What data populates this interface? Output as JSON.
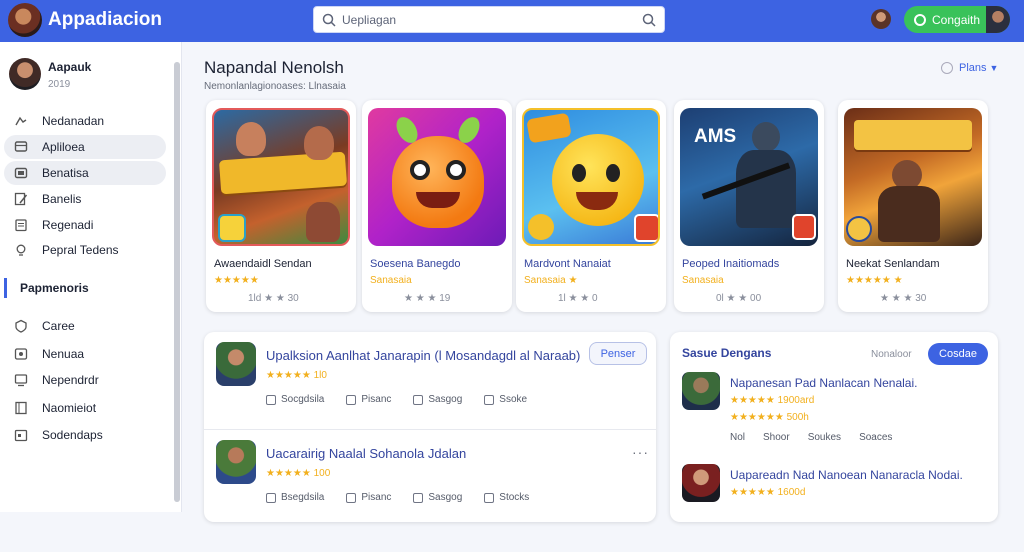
{
  "app": {
    "title": "Appadiacion"
  },
  "search": {
    "placeholder": "Uepliagan"
  },
  "topbar": {
    "cta_label": "Congaith"
  },
  "sidebar": {
    "profile": {
      "name": "Aapauk",
      "sub": "2019"
    },
    "items": [
      {
        "label": "Nedanadan",
        "icon": "accessibility-icon"
      },
      {
        "label": "Apliloea",
        "icon": "apps-icon"
      },
      {
        "label": "Benatisa",
        "icon": "folder-icon"
      },
      {
        "label": "Banelis",
        "icon": "edit-icon"
      },
      {
        "label": "Regenadi",
        "icon": "clipboard-icon"
      },
      {
        "label": "Pepral Tedens",
        "icon": "lightbulb-icon"
      }
    ],
    "section": "Papmenoris",
    "section_items": [
      {
        "label": "Caree",
        "icon": "shield-icon"
      },
      {
        "label": "Nenuaa",
        "icon": "gamepad-icon"
      },
      {
        "label": "Nependrdr",
        "icon": "monitor-icon"
      },
      {
        "label": "Naomieiot",
        "icon": "book-icon"
      },
      {
        "label": "Sodendaps",
        "icon": "calendar-icon"
      }
    ]
  },
  "featured": {
    "title": "Napandal Nenolsh",
    "subtitle": "Nemonlanlagionoases: Llnasaia",
    "sort_label": "Plans",
    "cards": [
      {
        "name": "Awaendaidl Sendan",
        "stars": "★★★★★",
        "meta": "1ld ★ ★ 30"
      },
      {
        "name": "Soesena Banegdo",
        "stars": "Sanasaia",
        "meta": "★ ★ ★ 19"
      },
      {
        "name": "Mardvont Nanaiat",
        "stars": "Sanasaia ★",
        "meta": "1l ★ ★ 0"
      },
      {
        "name": "Peoped Inaitiomads",
        "stars": "Sanasaia",
        "meta": "0l ★ ★ 00"
      },
      {
        "name": "Neekat Senlandam",
        "stars": "★★★★★ ★",
        "meta": "★ ★ ★ 30"
      }
    ]
  },
  "list": {
    "items": [
      {
        "title": "Upalksion Aanlhat Janarapin (l Mosandagdl al Naraab)",
        "rating": "★★★★★ 1l0",
        "actions": [
          "Socgdsila",
          "Pisanc",
          "Sasgog",
          "Ssoke"
        ],
        "button": "Penser"
      },
      {
        "title": "Uacarairig Naalal Sohanola Jdalan",
        "rating": "★★★★★ 100",
        "actions": [
          "Bsegdsila",
          "Pisanc",
          "Sasgog",
          "Stocks"
        ],
        "more": "···"
      }
    ]
  },
  "side": {
    "title": "Sasue Dengans",
    "link": "Nonaloor",
    "button": "Cosdae",
    "items": [
      {
        "title": "Napanesan Pad Nanlacan Nenalai.",
        "r1": "★★★★★ 1900ard",
        "r2": "★★★★★★ 500h",
        "actions": [
          "Nol",
          "Shoor",
          "Soukes",
          "Soaces"
        ]
      },
      {
        "title": "Uapareadn Nad Nanoean Nanaracla Nodai.",
        "r1": "★★★★★ 1600d",
        "r2": "",
        "actions": []
      }
    ]
  },
  "colors": {
    "brand": "#3d63e2",
    "cta": "#39c25a",
    "star": "#f2b01e"
  }
}
